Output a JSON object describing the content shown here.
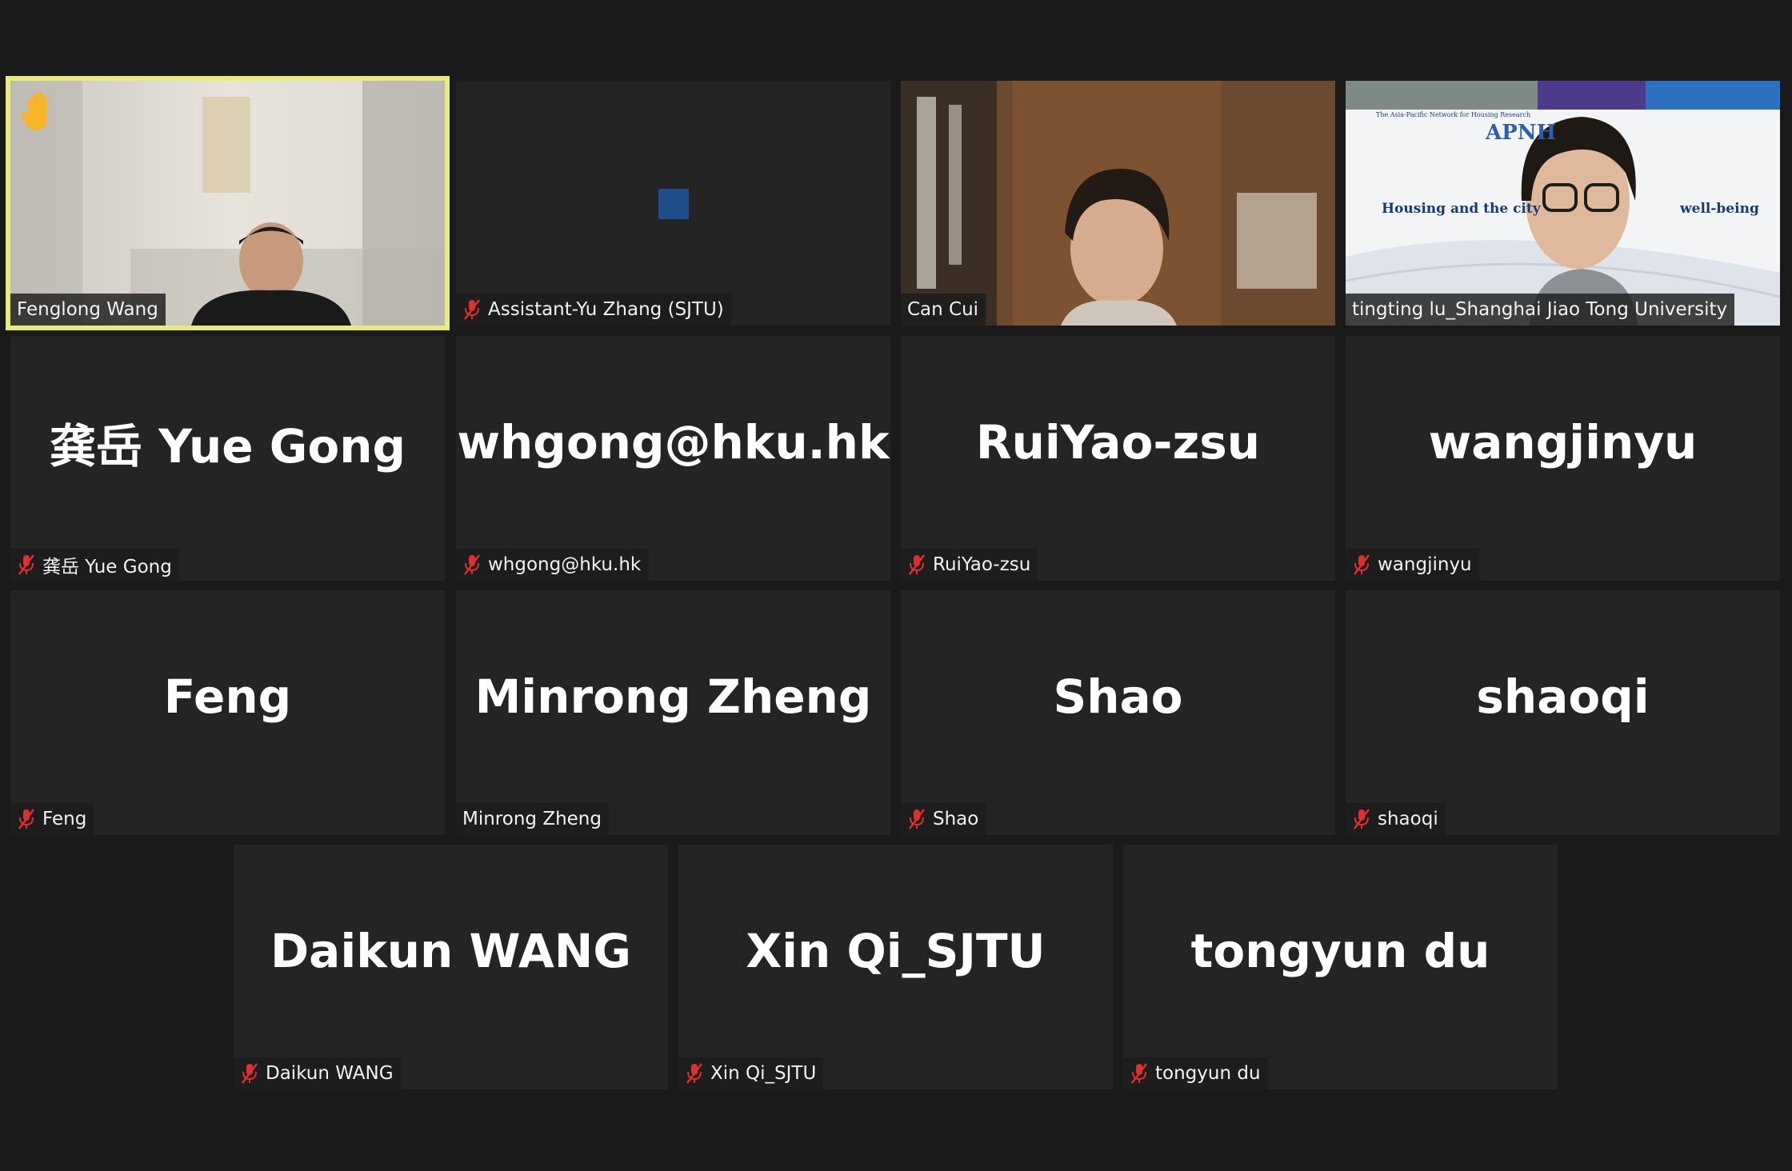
{
  "participants": [
    {
      "name": "Fenglong Wang",
      "display": "",
      "muted": false,
      "video": true,
      "hand_raised": true,
      "active_speaker": true
    },
    {
      "name": "Assistant-Yu Zhang (SJTU)",
      "display": "",
      "muted": true,
      "video": true
    },
    {
      "name": "Can Cui",
      "display": "",
      "muted": false,
      "video": true
    },
    {
      "name": "tingting lu_Shanghai Jiao Tong University",
      "display": "",
      "muted": false,
      "video": true
    },
    {
      "name": "龚岳 Yue Gong",
      "display": "龚岳 Yue Gong",
      "muted": true,
      "video": false
    },
    {
      "name": "whgong@hku.hk",
      "display": "whgong@hku.hk",
      "muted": true,
      "video": false
    },
    {
      "name": "RuiYao-zsu",
      "display": "RuiYao-zsu",
      "muted": true,
      "video": false
    },
    {
      "name": "wangjinyu",
      "display": "wangjinyu",
      "muted": true,
      "video": false
    },
    {
      "name": "Feng",
      "display": "Feng",
      "muted": true,
      "video": false
    },
    {
      "name": "Minrong Zheng",
      "display": "Minrong Zheng",
      "muted": false,
      "video": false
    },
    {
      "name": "Shao",
      "display": "Shao",
      "muted": true,
      "video": false
    },
    {
      "name": "shaoqi",
      "display": "shaoqi",
      "muted": true,
      "video": false
    },
    {
      "name": "Daikun WANG",
      "display": "Daikun WANG",
      "muted": true,
      "video": false
    },
    {
      "name": "Xin Qi_SJTU",
      "display": "Xin Qi_SJTU",
      "muted": true,
      "video": false
    },
    {
      "name": "tongyun du",
      "display": "tongyun du",
      "muted": true,
      "video": false
    }
  ],
  "shared_slide": {
    "network_name": "The Asia-Pacific Network for Housing Research",
    "acronym": "APNH",
    "headline_left": "Housing and the city",
    "headline_right": "well-being"
  },
  "colors": {
    "background": "#1a1a1a",
    "tile": "#242424",
    "active_speaker_border": "#e7ec7a",
    "muted_icon": "#e02f2f",
    "hand_icon": "#f7b52a"
  },
  "icons": {
    "muted": "microphone-muted-icon",
    "hand": "raised-hand-icon"
  }
}
